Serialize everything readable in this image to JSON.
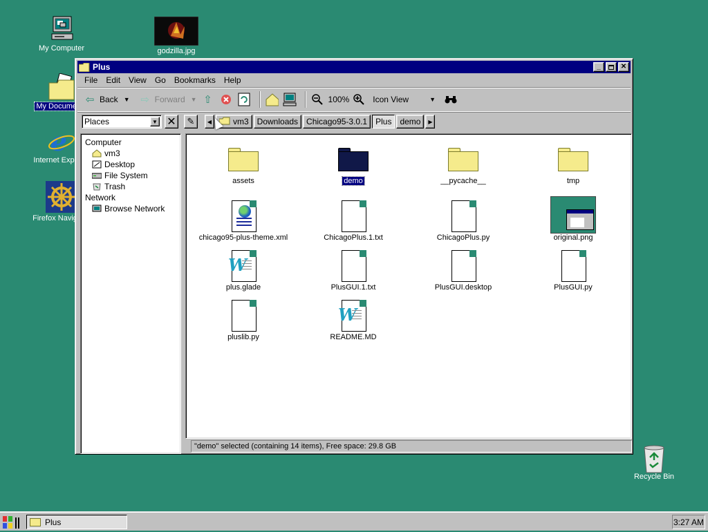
{
  "desktop": {
    "icons": [
      {
        "label": "My Computer",
        "icon": "computer-icon"
      },
      {
        "label": "godzilla.jpg",
        "icon": "image-icon"
      },
      {
        "label": "My Documents",
        "icon": "documents-folder-icon"
      },
      {
        "label": "Internet Explorer",
        "icon": "internet-explorer-icon"
      },
      {
        "label": "Firefox Navigator",
        "icon": "navigator-wheel-icon"
      },
      {
        "label": "Recycle Bin",
        "icon": "recycle-bin-icon"
      }
    ]
  },
  "window": {
    "title": "Plus",
    "menu": [
      "File",
      "Edit",
      "View",
      "Go",
      "Bookmarks",
      "Help"
    ],
    "toolbar": {
      "back": "Back",
      "forward": "Forward",
      "zoom": "100%",
      "view_mode": "Icon View"
    },
    "places": {
      "label": "Places"
    },
    "breadcrumbs": [
      "vm3",
      "Downloads",
      "Chicago95-3.0.1",
      "Plus",
      "demo"
    ],
    "sidebar": {
      "groups": [
        {
          "label": "Computer",
          "items": [
            "vm3",
            "Desktop",
            "File System",
            "Trash"
          ]
        },
        {
          "label": "Network",
          "items": [
            "Browse Network"
          ]
        }
      ]
    },
    "files": [
      {
        "name": "assets",
        "type": "folder"
      },
      {
        "name": "demo",
        "type": "folder",
        "selected": true
      },
      {
        "name": "__pycache__",
        "type": "folder"
      },
      {
        "name": "tmp",
        "type": "folder"
      },
      {
        "name": "chicago95-plus-theme.xml",
        "type": "xml"
      },
      {
        "name": "ChicagoPlus.1.txt",
        "type": "text"
      },
      {
        "name": "ChicagoPlus.py",
        "type": "text"
      },
      {
        "name": "original.png",
        "type": "image"
      },
      {
        "name": "plus.glade",
        "type": "word"
      },
      {
        "name": "PlusGUI.1.txt",
        "type": "text"
      },
      {
        "name": "PlusGUI.desktop",
        "type": "text"
      },
      {
        "name": "PlusGUI.py",
        "type": "text"
      },
      {
        "name": "pluslib.py",
        "type": "text"
      },
      {
        "name": "README.MD",
        "type": "word"
      }
    ],
    "status": "\"demo\" selected (containing 14 items), Free space: 29.8 GB"
  },
  "taskbar": {
    "task": "Plus",
    "clock": "3:27 AM"
  },
  "colors": {
    "desktop": "#2a8a72",
    "titlebar": "#000080",
    "face": "#c0c0c0",
    "folder": "#f5eb8c"
  }
}
